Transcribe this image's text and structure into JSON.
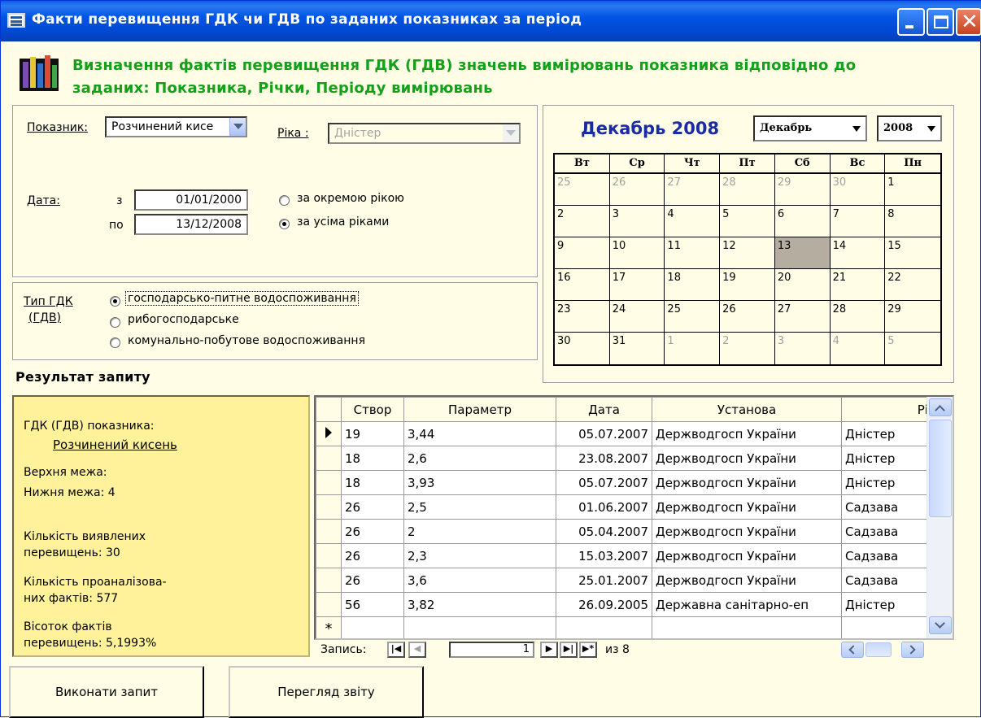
{
  "window": {
    "title": "Факти перевищення ГДК чи ГДВ по заданих показниках за період"
  },
  "header": {
    "line1": "Визначення фактів перевищення ГДК (ГДВ) значень вимірювань показника відповідно до",
    "line2": "заданих: Показника, Річки, Періоду вимірювань"
  },
  "filters": {
    "indicator_label": "Показник:",
    "indicator_value": "Розчинений кисе",
    "river_label": "Ріка :",
    "river_value": "Дністер",
    "date_label": "Дата:",
    "from_label": "з",
    "from_value": "01/01/2000",
    "to_label": "по",
    "to_value": "13/12/2008",
    "radio_single": "за окремою рікою",
    "radio_all": "за усіма ріками",
    "radio_selected": "all"
  },
  "gdk_type": {
    "label_line1": "Тип ГДК",
    "label_line2": "(ГДВ)",
    "options": [
      "господарсько-питне водоспоживання",
      "рибогосподарське",
      "комунально-побутове водоспоживання"
    ],
    "selected_index": 0
  },
  "calendar": {
    "title": "Декабрь 2008",
    "month_select": "Декабрь",
    "year_select": "2008",
    "weekdays": [
      "Вт",
      "Ср",
      "Чт",
      "Пт",
      "Сб",
      "Вс",
      "Пн"
    ],
    "weeks": [
      [
        {
          "d": "25",
          "out": true
        },
        {
          "d": "26",
          "out": true
        },
        {
          "d": "27",
          "out": true
        },
        {
          "d": "28",
          "out": true
        },
        {
          "d": "29",
          "out": true
        },
        {
          "d": "30",
          "out": true
        },
        {
          "d": "1",
          "out": false
        }
      ],
      [
        {
          "d": "2",
          "out": false
        },
        {
          "d": "3",
          "out": false
        },
        {
          "d": "4",
          "out": false
        },
        {
          "d": "5",
          "out": false
        },
        {
          "d": "6",
          "out": false
        },
        {
          "d": "7",
          "out": false
        },
        {
          "d": "8",
          "out": false
        }
      ],
      [
        {
          "d": "9",
          "out": false
        },
        {
          "d": "10",
          "out": false
        },
        {
          "d": "11",
          "out": false
        },
        {
          "d": "12",
          "out": false
        },
        {
          "d": "13",
          "out": false,
          "sel": true
        },
        {
          "d": "14",
          "out": false
        },
        {
          "d": "15",
          "out": false
        }
      ],
      [
        {
          "d": "16",
          "out": false
        },
        {
          "d": "17",
          "out": false
        },
        {
          "d": "18",
          "out": false
        },
        {
          "d": "19",
          "out": false
        },
        {
          "d": "20",
          "out": false
        },
        {
          "d": "21",
          "out": false
        },
        {
          "d": "22",
          "out": false
        }
      ],
      [
        {
          "d": "23",
          "out": false
        },
        {
          "d": "24",
          "out": false
        },
        {
          "d": "25",
          "out": false
        },
        {
          "d": "26",
          "out": false
        },
        {
          "d": "27",
          "out": false
        },
        {
          "d": "28",
          "out": false
        },
        {
          "d": "29",
          "out": false
        }
      ],
      [
        {
          "d": "30",
          "out": false
        },
        {
          "d": "31",
          "out": false
        },
        {
          "d": "1",
          "out": true
        },
        {
          "d": "2",
          "out": true
        },
        {
          "d": "3",
          "out": true
        },
        {
          "d": "4",
          "out": true
        },
        {
          "d": "5",
          "out": true
        }
      ]
    ],
    "selected_color": "#b5ad9f"
  },
  "results": {
    "title": "Результат запиту",
    "summary": {
      "gdk_label": "ГДК (ГДВ) показника:",
      "indicator": "Розчинений кисень",
      "upper_label": "Верхня межа:",
      "lower_label": "Нижня межа:  4",
      "found_line1": "Кількість виявлених",
      "found_line2": "перевищень:  30",
      "analyzed_line1": "Кількість проаналізова-",
      "analyzed_line2": "них фактів: 577",
      "percent_line1": "Вісоток фактів",
      "percent_line2": "перевищень: 5,1993%"
    },
    "columns": [
      "Створ",
      "Параметр",
      "Дата",
      "Установа",
      "Рік"
    ],
    "rows": [
      [
        "19",
        "3,44",
        "05.07.2007",
        "Держводгосп України",
        "Дністер"
      ],
      [
        "18",
        "2,6",
        "23.08.2007",
        "Держводгосп України",
        "Дністер"
      ],
      [
        "18",
        "3,93",
        "05.07.2007",
        "Держводгосп України",
        "Дністер"
      ],
      [
        "26",
        "2,5",
        "01.06.2007",
        "Держводгосп України",
        "Садзава"
      ],
      [
        "26",
        "2",
        "05.04.2007",
        "Держводгосп України",
        "Садзава"
      ],
      [
        "26",
        "2,3",
        "15.03.2007",
        "Держводгосп України",
        "Садзава"
      ],
      [
        "26",
        "3,6",
        "25.01.2007",
        "Держводгосп України",
        "Садзава"
      ],
      [
        "56",
        "3,82",
        "26.09.2005",
        "Державна санітарно-еп",
        "Дністер"
      ]
    ],
    "new_row_marker": "*",
    "nav": {
      "record_label": "Запись:",
      "current": "1",
      "total_label": "из 8"
    }
  },
  "buttons": {
    "run_query": "Виконати запит",
    "view_report": "Перегляд звіту"
  },
  "colors": {
    "form_bg": "#fffde6",
    "header_green": "#14a01a",
    "calendar_title": "#1a2ca3",
    "summary_bg": "#fff29a",
    "titlebar_blue": "#0054e3"
  }
}
